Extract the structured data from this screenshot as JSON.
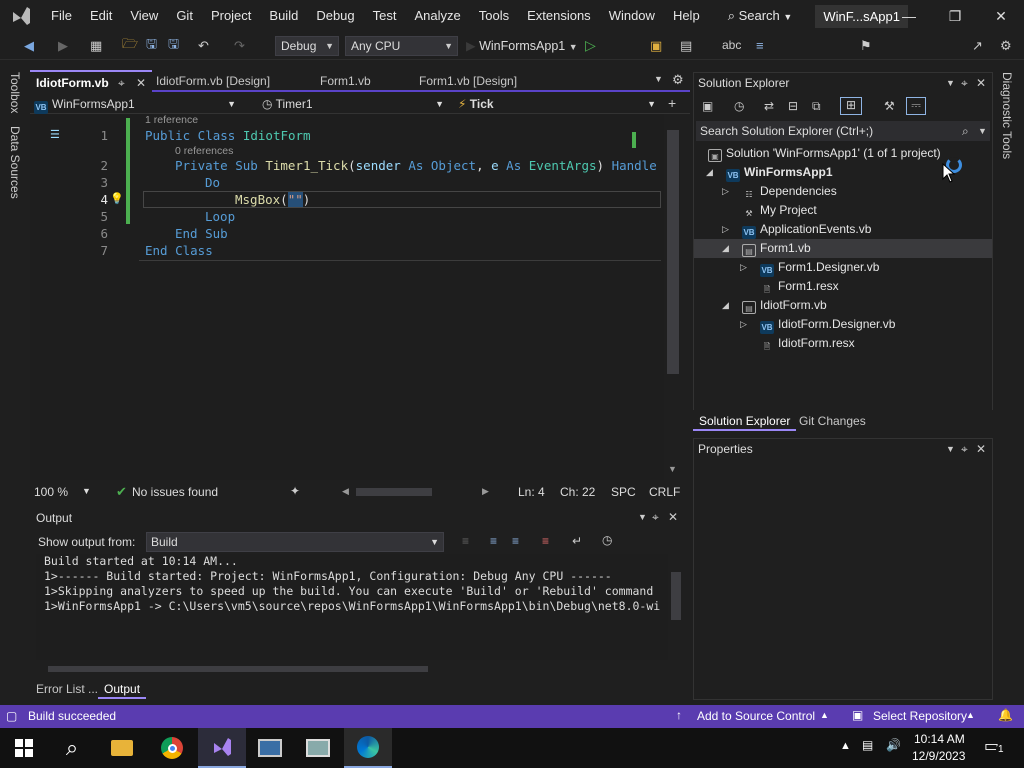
{
  "app": {
    "menus": [
      "File",
      "Edit",
      "View",
      "Git",
      "Project",
      "Build",
      "Debug",
      "Test",
      "Analyze",
      "Tools",
      "Extensions",
      "Window",
      "Help"
    ],
    "search_label": "Search",
    "solution_short": "WinF...sApp1"
  },
  "toolbar": {
    "config": "Debug",
    "platform": "Any CPU",
    "startup": "WinFormsApp1"
  },
  "left_strip": {
    "toolbox": "Toolbox",
    "data_sources": "Data Sources"
  },
  "right_strip": {
    "diagnostic": "Diagnostic Tools"
  },
  "doc_tabs": [
    "IdiotForm.vb",
    "IdiotForm.vb [Design]",
    "Form1.vb",
    "Form1.vb [Design]"
  ],
  "nav": {
    "project": "WinFormsApp1",
    "member_class": "Timer1",
    "member": "Tick"
  },
  "editor": {
    "line_numbers": [
      "1",
      "2",
      "3",
      "4",
      "5",
      "6",
      "7"
    ],
    "codelens_class": "1 reference",
    "codelens_method": "0 references",
    "line1": {
      "kw1": "Public Class ",
      "name": "IdiotForm"
    },
    "line2": {
      "kw1": "Private Sub ",
      "name": "Timer1_Tick",
      "p1": "(",
      "sender": "sender",
      "as1": " As ",
      "t1": "Object",
      "c": ", ",
      "e": "e",
      "as2": " As ",
      "t2": "EventArgs",
      "p2": ") ",
      "tail": "Handle"
    },
    "line3": "Do",
    "line4": {
      "fn": "MsgBox",
      "p1": "(",
      "str": "\"\"",
      "p2": ")"
    },
    "line5": "Loop",
    "line6": "End Sub",
    "line7": "End Class"
  },
  "status_line": {
    "zoom": "100 %",
    "issues": "No issues found",
    "ln": "Ln: 4",
    "ch": "Ch: 22",
    "spc": "SPC",
    "crlf": "CRLF"
  },
  "output": {
    "title": "Output",
    "show_label": "Show output from:",
    "source": "Build",
    "lines": [
      "Build started at 10:14 AM...",
      "1>------ Build started: Project: WinFormsApp1, Configuration: Debug Any CPU ------",
      "1>Skipping analyzers to speed up the build. You can execute 'Build' or 'Rebuild' command",
      "1>WinFormsApp1 -> C:\\Users\\vm5\\source\\repos\\WinFormsApp1\\WinFormsApp1\\bin\\Debug\\net8.0-wi"
    ]
  },
  "bottom_tabs": [
    "Error List ...",
    "Output"
  ],
  "solution_explorer": {
    "title": "Solution Explorer",
    "search_placeholder": "Search Solution Explorer (Ctrl+;)",
    "items": [
      {
        "label": "Solution 'WinFormsApp1' (1 of 1 project)"
      },
      {
        "label": "WinFormsApp1"
      },
      {
        "label": "Dependencies"
      },
      {
        "label": "My Project"
      },
      {
        "label": "ApplicationEvents.vb"
      },
      {
        "label": "Form1.vb"
      },
      {
        "label": "Form1.Designer.vb"
      },
      {
        "label": "Form1.resx"
      },
      {
        "label": "IdiotForm.vb"
      },
      {
        "label": "IdiotForm.Designer.vb"
      },
      {
        "label": "IdiotForm.resx"
      }
    ],
    "tabs": [
      "Solution Explorer",
      "Git Changes"
    ]
  },
  "properties": {
    "title": "Properties"
  },
  "statusbar": {
    "left": "Build succeeded",
    "source_control": "Add to Source Control",
    "repo": "Select Repository"
  },
  "taskbar": {
    "time": "10:14 AM",
    "date": "12/9/2023",
    "notifications": "1"
  },
  "colors": {
    "accent": "#5a3cb0",
    "tab_active": "#9b87f5",
    "keyword": "#569cd6",
    "type": "#4ec9b0"
  }
}
